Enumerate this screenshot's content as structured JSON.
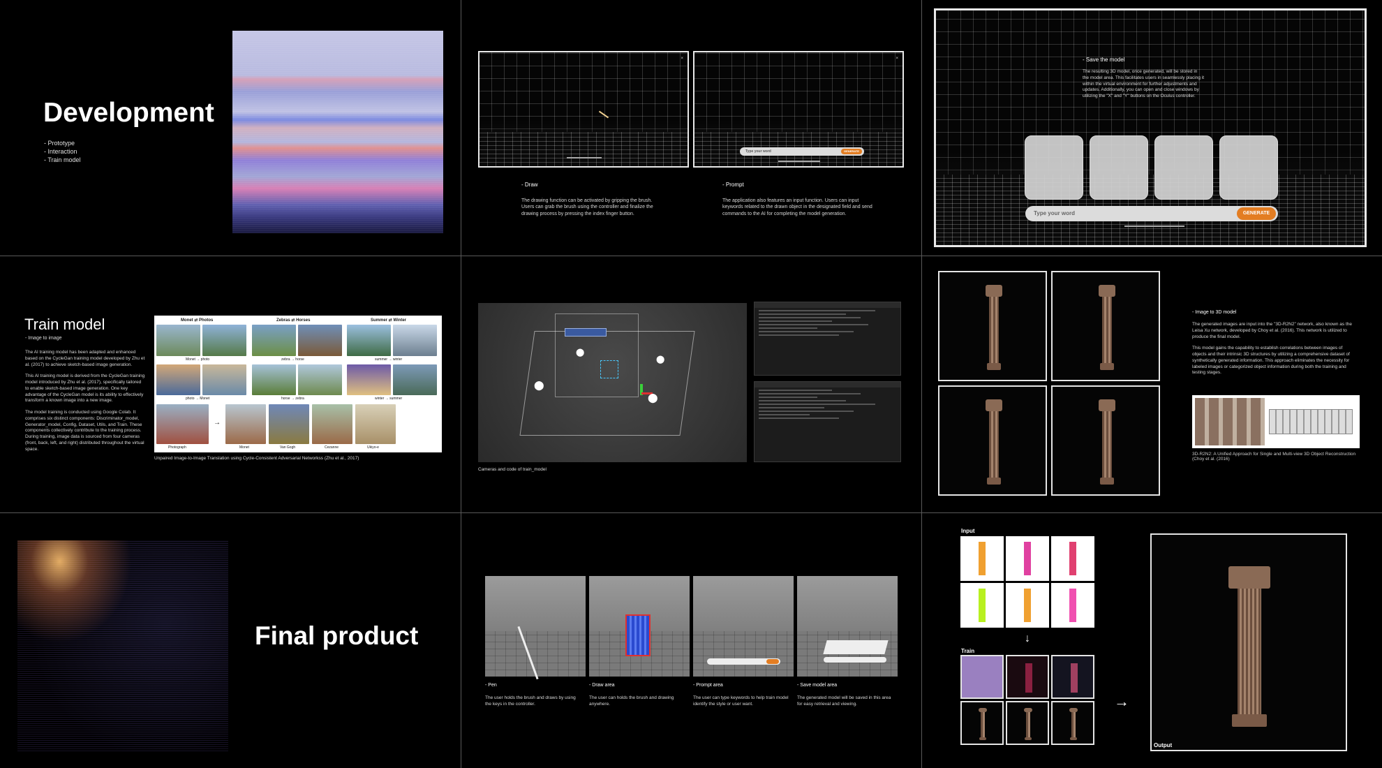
{
  "development": {
    "title": "Development",
    "items": [
      "- Prototype",
      "- Interaction",
      "- Train model"
    ]
  },
  "draw": {
    "heading": "- Draw",
    "body": "The drawing function can be activated by gripping the brush. Users can grab the brush using the controller and finalize the drawing process by pressing the index finger button."
  },
  "prompt": {
    "heading": "- Prompt",
    "body": "The application also features an input function. Users can input keywords related to the drawn object in the designated field and send commands to the AI for completing the model generation.",
    "input_placeholder": "Type your word",
    "generate_label": "GENERATE"
  },
  "save": {
    "heading": "- Save the model",
    "body": "The resulting 3D model, once generated, will be stored in the model area. This facilitates users in seamlessly placing it within the virtual environment for further adjustments and updates. Additionally, you can open and close windows by utilizing the \"X\" and \"Y\" buttons on the Oculus controller.",
    "input_placeholder": "Type your word",
    "generate_label": "GENERATE"
  },
  "train": {
    "title": "Train model",
    "subtitle": "- Image to image",
    "p1": "The AI training model has been adapted and enhanced based on the CycleGan training model developed by Zhu et al. (2017) to achieve sketch-based image generation.",
    "p2": "This AI training model is derived from the CycleGan training model introduced by Zhu et al. (2017), specifically tailored to enable sketch-based image generation. One key advantage of the CycleGan model is its ability to effectively transform a known image into a new image.",
    "p3": "The model training is conducted using Google Colab. It comprises six distinct components: Discriminator_model, Generator_model, Config, Dataset, Utils, and Train. These components collectively contribute to the training process. During training, image data is sourced from four cameras (front, back, left, and right) distributed throughout the virtual space.",
    "figure_headers": [
      "Monet",
      "Photos",
      "Zebras",
      "Horses",
      "Summer",
      "Winter"
    ],
    "figure_labels": [
      "Monet → photo",
      "zebra → horse",
      "summer → winter",
      "photo → Monet",
      "horse → zebra",
      "winter → summer"
    ],
    "style_labels": [
      "Photograph",
      "Monet",
      "Van Gogh",
      "Cezanne",
      "Ukiyo-e"
    ],
    "caption": "Unpaired Image-to-Image Translation using Cycle-Consistent Adversarial Networkss (Zhu et al., 2017)"
  },
  "cameras": {
    "caption": "Cameras and code of train_model"
  },
  "r2n2": {
    "heading": "- Image to 3D model",
    "p1": "The generated images are input into the \"3D-R2N2\" network, also known as the Leisa Xu network, developed by Choy et al. (2016). This network is utilized to produce the final model.",
    "p2": "This model gains the capability to establish correlations between images of objects and their intrinsic 3D structures by utilizing a comprehensive dataset of synthetically generated information. This approach eliminates the necessity for labeled images or categorized object information during both the training and testing stages.",
    "caption": "3D-R2N2: A Unified Approach for Single and Multi-view 3D Object Reconstruction (Choy et al. (2016)"
  },
  "final": {
    "title": "Final product"
  },
  "features": [
    {
      "heading": "- Pen",
      "body": "The user holds the brush and draws by using the keys in the controller."
    },
    {
      "heading": "- Draw area",
      "body": "The user can holds the brush and drawing anywhere."
    },
    {
      "heading": "- Prompt area",
      "body": "The user can type keywords to help train model identify the style or user want."
    },
    {
      "heading": "- Save model area",
      "body": "The generated model will be saved in this area for easy retrieval and viewing."
    }
  ],
  "pipeline": {
    "input_label": "Input",
    "train_label": "Train",
    "output_label": "Output",
    "input_colors": [
      "#f0a030",
      "#e040a0",
      "#e04070",
      "#b8f020",
      "#f0a030",
      "#f050b0"
    ]
  }
}
